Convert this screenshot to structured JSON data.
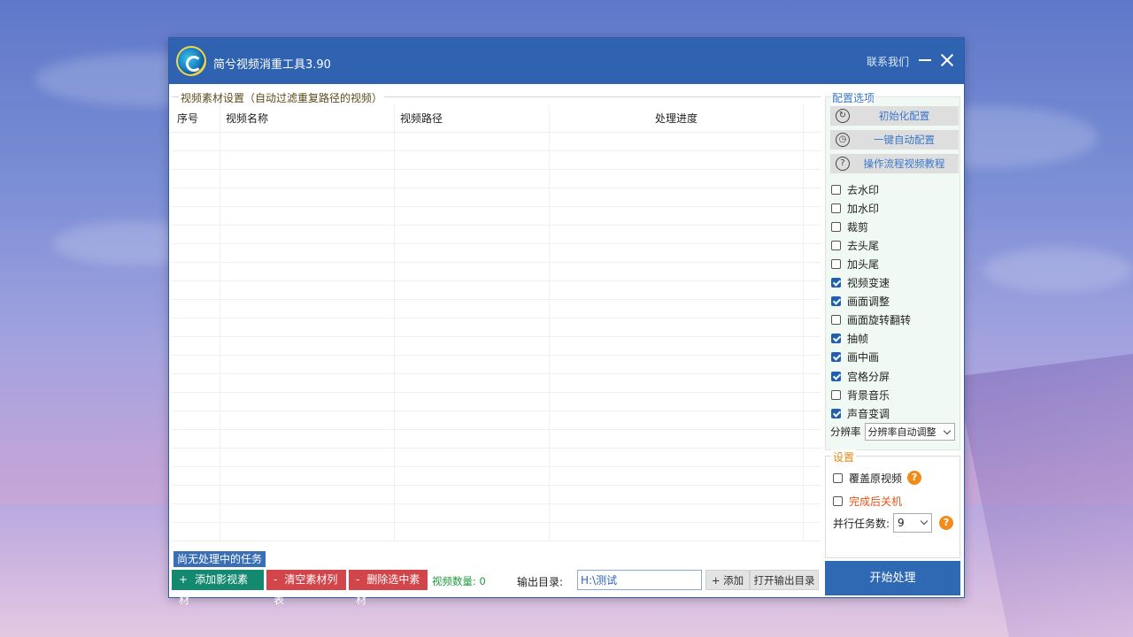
{
  "window": {
    "title": "简兮视频消重工具3.90",
    "contact": "联系我们"
  },
  "materials": {
    "group_title": "视频素材设置（自动过滤重复路径的视频）",
    "columns": [
      "序号",
      "视频名称",
      "视频路径",
      "处理进度"
    ],
    "rows": []
  },
  "status": "尚无处理中的任务",
  "bottom": {
    "add_sym": "+",
    "add_label": "添加影视素材",
    "clear_sym": "-",
    "clear_label": "清空素材列表",
    "delete_sym": "-",
    "delete_label": "删除选中素材",
    "video_count": "视频数量:  0",
    "output_label": "输出目录:",
    "output_value": "H:\\测试",
    "add_button": "+ 添加",
    "open_output": "打开输出目录"
  },
  "config": {
    "title": "配置选项",
    "init_btn": "初始化配置",
    "auto_btn": "一键自动配置",
    "tutorial_btn": "操作流程视频教程",
    "options": [
      {
        "label": "去水印",
        "checked": false
      },
      {
        "label": "加水印",
        "checked": false
      },
      {
        "label": "裁剪",
        "checked": false
      },
      {
        "label": "去头尾",
        "checked": false
      },
      {
        "label": "加头尾",
        "checked": false
      },
      {
        "label": "视频变速",
        "checked": true
      },
      {
        "label": "画面调整",
        "checked": true
      },
      {
        "label": "画面旋转翻转",
        "checked": false
      },
      {
        "label": "抽帧",
        "checked": true
      },
      {
        "label": "画中画",
        "checked": true
      },
      {
        "label": "宫格分屏",
        "checked": true
      },
      {
        "label": "背景音乐",
        "checked": false
      },
      {
        "label": "声音变调",
        "checked": true
      }
    ],
    "resolution_label": "分辨率",
    "resolution_value": "分辨率自动调整"
  },
  "settings": {
    "title": "设置",
    "overwrite": "覆盖原视频",
    "shutdown": "完成后关机",
    "parallel_label": "并行任务数:",
    "parallel_value": "9",
    "help": "?"
  },
  "start_button": "开始处理",
  "colors": {
    "title_bar": "#2f63b1",
    "green_button": "#138a6f",
    "red_button": "#d2454a",
    "accent_blue": "#3a77c8",
    "warning_orange": "#e38a14"
  }
}
